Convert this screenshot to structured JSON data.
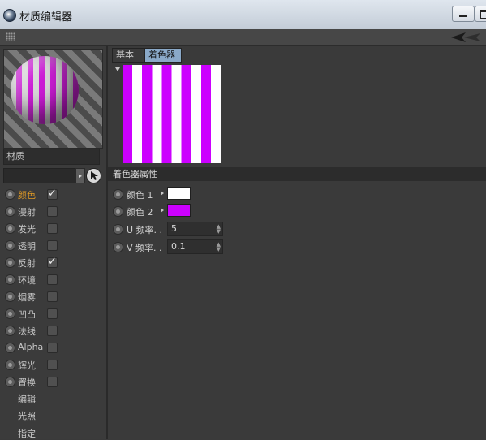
{
  "window": {
    "title": "材质编辑器",
    "minimize_label": "最小化",
    "maximize_label": "最大化"
  },
  "material": {
    "name": "材质"
  },
  "channels": [
    {
      "label": "颜色",
      "checked": true,
      "active": true
    },
    {
      "label": "漫射",
      "checked": false,
      "active": false
    },
    {
      "label": "发光",
      "checked": false,
      "active": false
    },
    {
      "label": "透明",
      "checked": false,
      "active": false
    },
    {
      "label": "反射",
      "checked": true,
      "active": false
    },
    {
      "label": "环境",
      "checked": false,
      "active": false
    },
    {
      "label": "烟雾",
      "checked": false,
      "active": false
    },
    {
      "label": "凹凸",
      "checked": false,
      "active": false
    },
    {
      "label": "法线",
      "checked": false,
      "active": false
    },
    {
      "label": "Alpha",
      "checked": false,
      "active": false
    },
    {
      "label": "辉光",
      "checked": false,
      "active": false
    },
    {
      "label": "置换",
      "checked": false,
      "active": false
    }
  ],
  "modes": [
    "编辑",
    "光照",
    "指定"
  ],
  "tabs": {
    "basic": "基本",
    "shader": "着色器"
  },
  "shader_section": {
    "title": "着色器属性"
  },
  "params": {
    "color1": {
      "label": "颜色 1",
      "color": "#ffffff"
    },
    "color2": {
      "label": "颜色 2",
      "color": "#cc00ff"
    },
    "u_freq": {
      "label": "U 频率. .",
      "value": "5"
    },
    "v_freq": {
      "label": "V 频率. .",
      "value": "0.1"
    }
  },
  "colors": {
    "accent_active": "#e09a25",
    "stripe": "#cc00ff",
    "tab_selected": "#8aa9c8"
  }
}
